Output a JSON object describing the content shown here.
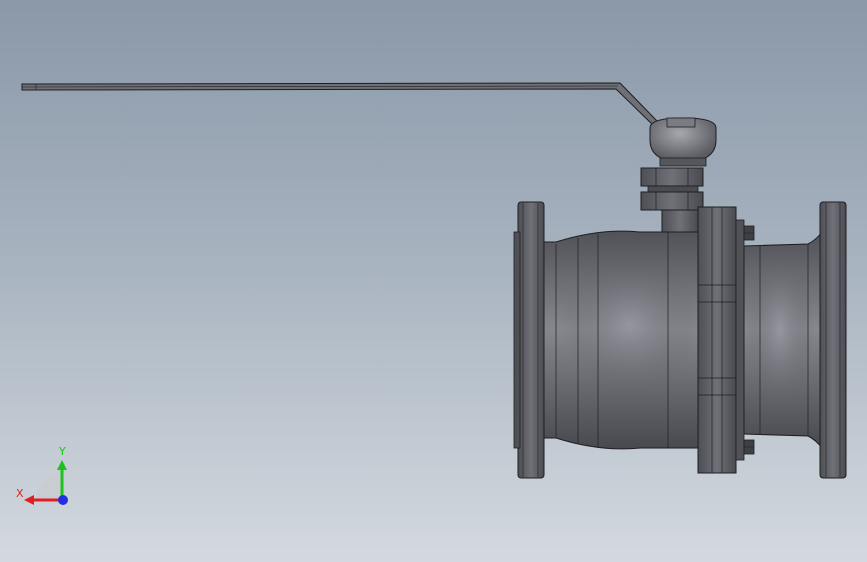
{
  "viewport": {
    "background_top": "#8a98a8",
    "background_bottom": "#d3d9df"
  },
  "model": {
    "body_color": "#5e6066",
    "outline_color": "#1e1e22",
    "handle_color": "#6e7076"
  },
  "triad": {
    "x_label": "X",
    "y_label": "Y",
    "x_color": "#e02020",
    "y_color": "#20c020",
    "z_color": "#2030e0"
  }
}
